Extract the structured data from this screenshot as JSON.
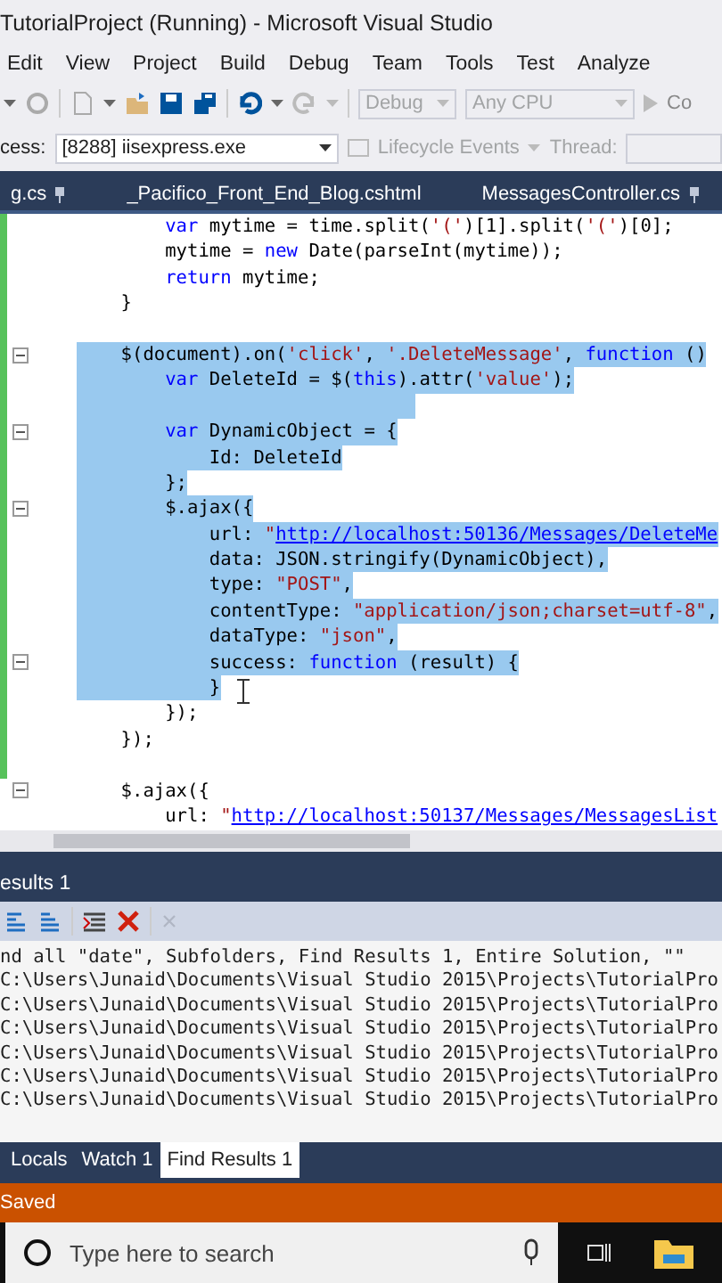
{
  "window": {
    "title": "TutorialProject (Running) - Microsoft Visual Studio"
  },
  "menu": [
    "Edit",
    "View",
    "Project",
    "Build",
    "Debug",
    "Team",
    "Tools",
    "Test",
    "Analyze"
  ],
  "toolbar": {
    "config": "Debug",
    "platform": "Any CPU",
    "start": "Co"
  },
  "debug_bar": {
    "label": "cess:",
    "process": "[8288] iisexpress.exe",
    "lifecycle": "Lifecycle Events",
    "thread_label": "Thread:"
  },
  "tabs": [
    {
      "label": "g.cs",
      "pinned": true,
      "selected": false
    },
    {
      "label": "_Pacifico_Front_End_Blog.cshtml",
      "pinned": false,
      "selected": false
    },
    {
      "label": "MessagesController.cs",
      "pinned": true,
      "selected": false
    }
  ],
  "editor": {
    "lines": [
      {
        "changed": true,
        "selected": false,
        "collapsible": false,
        "tokens": [
          {
            "kind": "keyword",
            "text": "        var"
          },
          {
            "kind": "plain",
            "text": " mytime = time.split("
          },
          {
            "kind": "string",
            "text": "'('"
          },
          {
            "kind": "plain",
            "text": ")[1].split("
          },
          {
            "kind": "string",
            "text": "'('"
          },
          {
            "kind": "plain",
            "text": ")[0];"
          }
        ]
      },
      {
        "changed": true,
        "selected": false,
        "collapsible": false,
        "tokens": [
          {
            "kind": "plain",
            "text": "        mytime = "
          },
          {
            "kind": "keyword",
            "text": "new"
          },
          {
            "kind": "plain",
            "text": " Date(parseInt(mytime));"
          }
        ]
      },
      {
        "changed": true,
        "selected": false,
        "collapsible": false,
        "tokens": [
          {
            "kind": "keyword",
            "text": "        return"
          },
          {
            "kind": "plain",
            "text": " mytime;"
          }
        ]
      },
      {
        "changed": true,
        "selected": false,
        "collapsible": false,
        "tokens": [
          {
            "kind": "plain",
            "text": "    }"
          }
        ]
      },
      {
        "changed": true,
        "selected": false,
        "collapsible": false
      },
      {
        "changed": true,
        "selected": true,
        "collapsible": true,
        "tokens": [
          {
            "kind": "plain",
            "text": "    $(document).on("
          },
          {
            "kind": "string",
            "text": "'click'"
          },
          {
            "kind": "plain",
            "text": ", "
          },
          {
            "kind": "string",
            "text": "'.DeleteMessage'"
          },
          {
            "kind": "plain",
            "text": ", "
          },
          {
            "kind": "keyword",
            "text": "function"
          },
          {
            "kind": "plain",
            "text": " ()"
          }
        ]
      },
      {
        "changed": true,
        "selected": true,
        "collapsible": false,
        "tokens": [
          {
            "kind": "keyword",
            "text": "        var"
          },
          {
            "kind": "plain",
            "text": " DeleteId = $("
          },
          {
            "kind": "keyword",
            "text": "this"
          },
          {
            "kind": "plain",
            "text": ").attr("
          },
          {
            "kind": "string",
            "text": "'value'"
          },
          {
            "kind": "plain",
            "text": ");"
          }
        ]
      },
      {
        "changed": true,
        "selected": true,
        "collapsible": false
      },
      {
        "changed": true,
        "selected": true,
        "collapsible": true,
        "tokens": [
          {
            "kind": "keyword",
            "text": "        var"
          },
          {
            "kind": "plain",
            "text": " DynamicObject = {"
          }
        ]
      },
      {
        "changed": true,
        "selected": true,
        "collapsible": false,
        "tokens": [
          {
            "kind": "plain",
            "text": "            Id: DeleteId"
          }
        ]
      },
      {
        "changed": true,
        "selected": true,
        "collapsible": false,
        "tokens": [
          {
            "kind": "plain",
            "text": "        };"
          }
        ]
      },
      {
        "changed": true,
        "selected": true,
        "collapsible": true,
        "tokens": [
          {
            "kind": "plain",
            "text": "        $.ajax({"
          }
        ]
      },
      {
        "changed": true,
        "selected": true,
        "collapsible": false,
        "tokens": [
          {
            "kind": "plain",
            "text": "            url: "
          },
          {
            "kind": "string",
            "text": "\""
          },
          {
            "kind": "link",
            "text": "http://localhost:50136/Messages/DeleteMe"
          }
        ]
      },
      {
        "changed": true,
        "selected": true,
        "collapsible": false,
        "tokens": [
          {
            "kind": "plain",
            "text": "            data: JSON.stringify(DynamicObject),"
          }
        ]
      },
      {
        "changed": true,
        "selected": true,
        "collapsible": false,
        "tokens": [
          {
            "kind": "plain",
            "text": "            type: "
          },
          {
            "kind": "string",
            "text": "\"POST\""
          },
          {
            "kind": "plain",
            "text": ","
          }
        ]
      },
      {
        "changed": true,
        "selected": true,
        "collapsible": false,
        "tokens": [
          {
            "kind": "plain",
            "text": "            contentType: "
          },
          {
            "kind": "string",
            "text": "\"application/json;charset=utf-8\""
          },
          {
            "kind": "plain",
            "text": ","
          }
        ]
      },
      {
        "changed": true,
        "selected": true,
        "collapsible": false,
        "tokens": [
          {
            "kind": "plain",
            "text": "            dataType: "
          },
          {
            "kind": "string",
            "text": "\"json\""
          },
          {
            "kind": "plain",
            "text": ","
          }
        ]
      },
      {
        "changed": true,
        "selected": true,
        "collapsible": true,
        "tokens": [
          {
            "kind": "plain",
            "text": "            success: "
          },
          {
            "kind": "keyword",
            "text": "function"
          },
          {
            "kind": "plain",
            "text": " (result) {"
          }
        ]
      },
      {
        "changed": true,
        "selected": true,
        "collapsible": false,
        "tokens": [
          {
            "kind": "plain",
            "text": "            }"
          }
        ]
      },
      {
        "changed": true,
        "selected": false,
        "collapsible": false,
        "tokens": [
          {
            "kind": "plain",
            "text": "        });"
          }
        ]
      },
      {
        "changed": true,
        "selected": false,
        "collapsible": false,
        "tokens": [
          {
            "kind": "plain",
            "text": "    });"
          }
        ]
      },
      {
        "changed": true,
        "selected": false,
        "collapsible": false
      },
      {
        "changed": false,
        "selected": false,
        "collapsible": true,
        "tokens": [
          {
            "kind": "plain",
            "text": "    $.ajax({"
          }
        ]
      },
      {
        "changed": false,
        "selected": false,
        "collapsible": false,
        "tokens": [
          {
            "kind": "plain",
            "text": "        url: "
          },
          {
            "kind": "string",
            "text": "\""
          },
          {
            "kind": "link",
            "text": "http://localhost:50137/Messages/MessagesList"
          }
        ]
      }
    ]
  },
  "find_results": {
    "title": "esults 1",
    "lines": [
      "nd all \"date\", Subfolders, Find Results 1, Entire Solution, \"\"",
      "C:\\Users\\Junaid\\Documents\\Visual Studio 2015\\Projects\\TutorialPro",
      "C:\\Users\\Junaid\\Documents\\Visual Studio 2015\\Projects\\TutorialPro",
      "C:\\Users\\Junaid\\Documents\\Visual Studio 2015\\Projects\\TutorialPro",
      "C:\\Users\\Junaid\\Documents\\Visual Studio 2015\\Projects\\TutorialPro",
      "C:\\Users\\Junaid\\Documents\\Visual Studio 2015\\Projects\\TutorialPro",
      "C:\\Users\\Junaid\\Documents\\Visual Studio 2015\\Projects\\TutorialPro"
    ]
  },
  "bottom_tabs": [
    {
      "label": "Locals",
      "selected": false
    },
    {
      "label": "Watch 1",
      "selected": false
    },
    {
      "label": "Find Results 1",
      "selected": true
    }
  ],
  "status_bar": {
    "text": "Saved"
  },
  "taskbar": {
    "search": {
      "placeholder": "Type here to search"
    }
  }
}
